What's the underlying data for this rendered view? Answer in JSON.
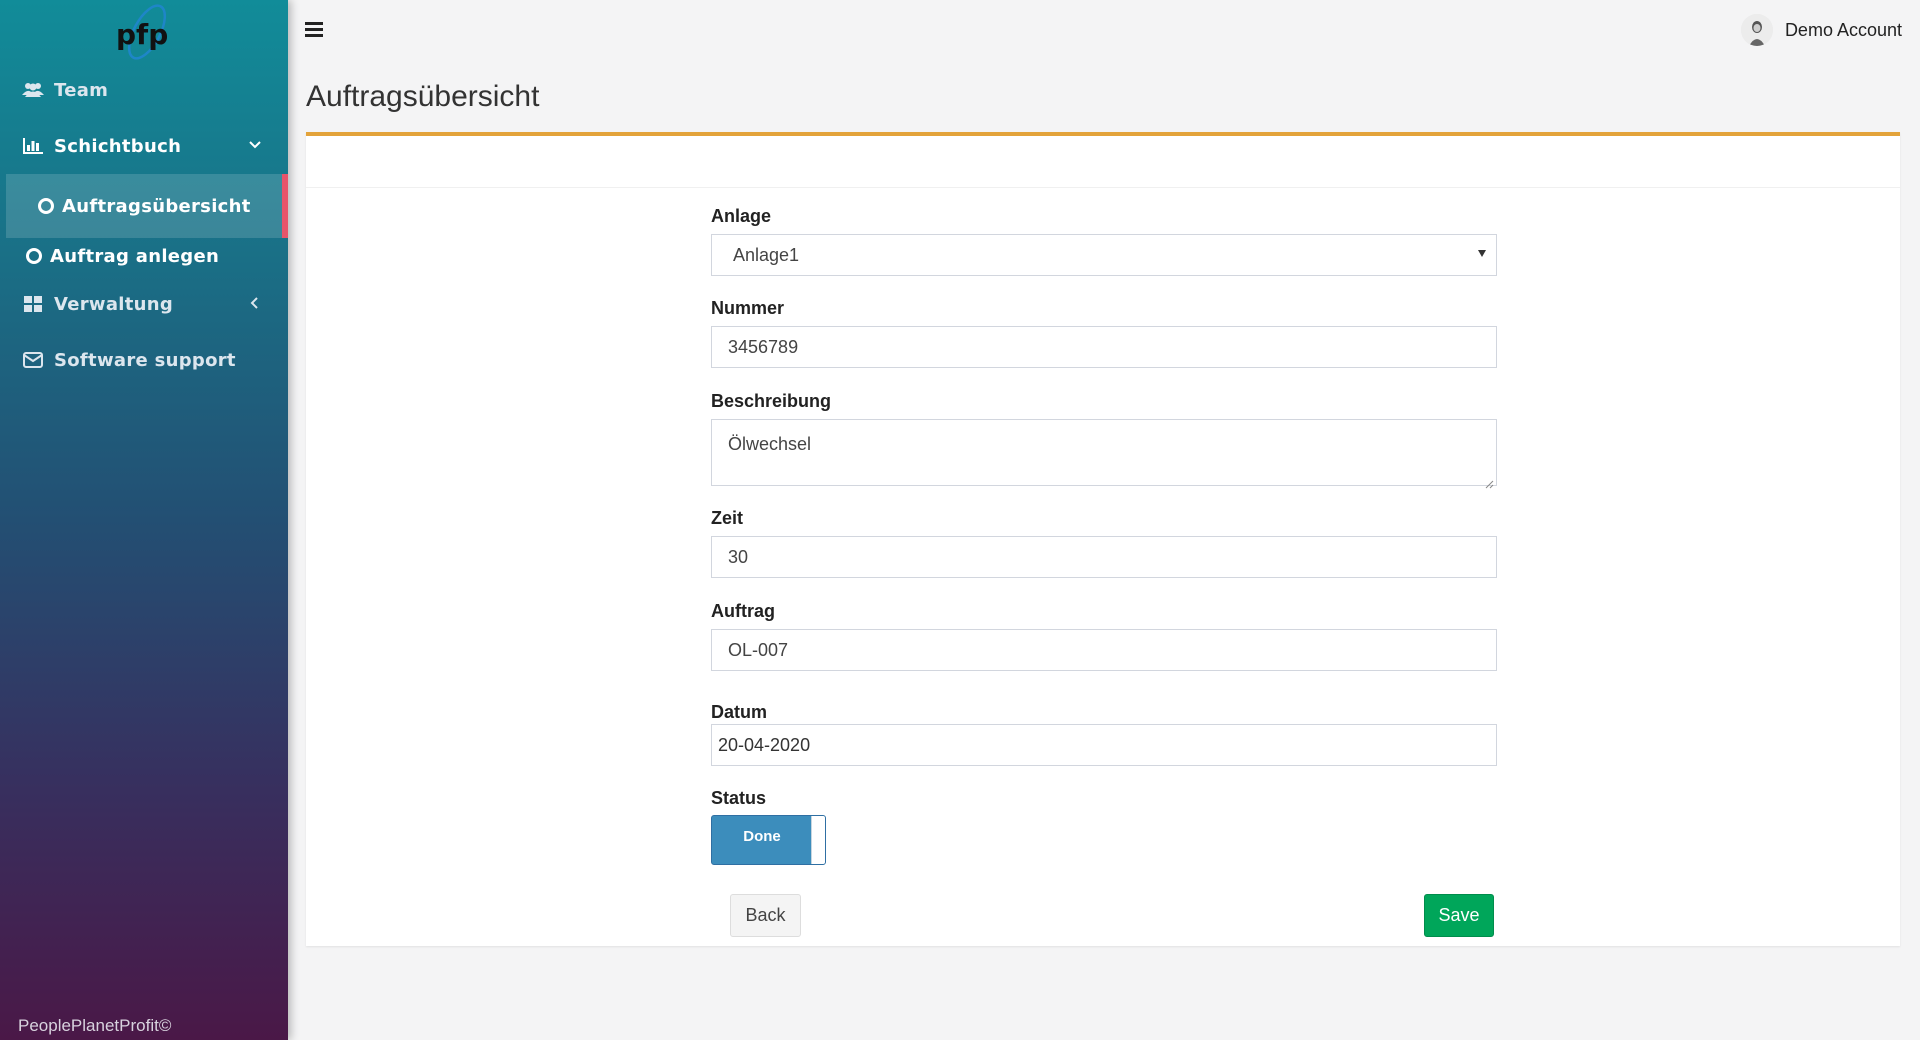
{
  "sidebar": {
    "logo_text": "pfp",
    "items": [
      {
        "label": "Team",
        "icon": "users-icon"
      },
      {
        "label": "Schichtbuch",
        "icon": "bar-chart-icon",
        "expanded": true
      },
      {
        "label": "Auftragsübersicht",
        "icon": "circle-icon",
        "active": true
      },
      {
        "label": "Auftrag anlegen",
        "icon": "circle-icon"
      },
      {
        "label": "Verwaltung",
        "icon": "grid-icon",
        "expanded": false
      },
      {
        "label": "Software support",
        "icon": "envelope-icon"
      }
    ],
    "footer": "PeoplePlanetProfit©"
  },
  "header": {
    "menu_icon": "hamburger-icon",
    "account_name": "Demo Account"
  },
  "page": {
    "title": "Auftragsübersicht"
  },
  "form": {
    "anlage": {
      "label": "Anlage",
      "value": "Anlage1"
    },
    "nummer": {
      "label": "Nummer",
      "value": "3456789"
    },
    "beschreibung": {
      "label": "Beschreibung",
      "value": "Ölwechsel"
    },
    "zeit": {
      "label": "Zeit",
      "value": "30"
    },
    "auftrag": {
      "label": "Auftrag",
      "value": "OL-007"
    },
    "datum": {
      "label": "Datum",
      "value": "20-04-2020"
    },
    "status": {
      "label": "Status",
      "value": "Done"
    }
  },
  "buttons": {
    "back": "Back",
    "save": "Save"
  },
  "colors": {
    "accent_border": "#e3a33a",
    "active_marker": "#e8546a",
    "toggle": "#3c8dbc",
    "save": "#00a65a"
  }
}
